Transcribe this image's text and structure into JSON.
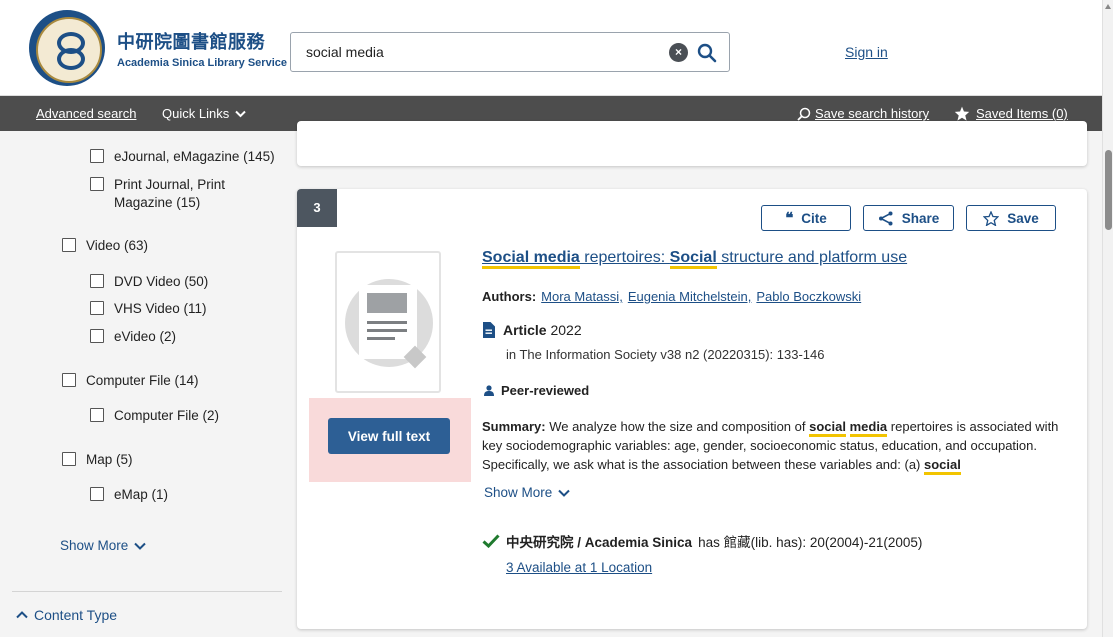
{
  "header": {
    "logo_zh": "中研院圖書館服務",
    "logo_en": "Academia Sinica Library Service",
    "search_value": "social media",
    "signin": "Sign in"
  },
  "nav": {
    "advanced_search": "Advanced search",
    "quick_links": "Quick Links",
    "save_history": "Save search history",
    "saved_items": "Saved Items (0)"
  },
  "sidebar": {
    "facets": [
      {
        "label": "eJournal, eMagazine (145)"
      },
      {
        "label": "Print Journal, Print Magazine (15)"
      },
      {
        "label": "Video (63)"
      },
      {
        "label": "DVD Video (50)"
      },
      {
        "label": "VHS Video (11)"
      },
      {
        "label": "eVideo (2)"
      },
      {
        "label": "Computer File (14)"
      },
      {
        "label": "Computer File (2)"
      },
      {
        "label": "Map (5)"
      },
      {
        "label": "eMap (1)"
      }
    ],
    "show_more": "Show More",
    "content_type": "Content Type"
  },
  "result": {
    "rank": "3",
    "cite": "Cite",
    "share": "Share",
    "save": "Save",
    "title_parts": [
      "Social media",
      " repertoires: ",
      "Social",
      " structure and platform use"
    ],
    "authors_label": "Authors:",
    "authors": [
      "Mora Matassi,",
      "Eugenia Mitchelstein,",
      "Pablo Boczkowski"
    ],
    "type_label": "Article",
    "year": "2022",
    "publication": "in The Information Society  v38 n2 (20220315): 133-146",
    "peer_reviewed": "Peer-reviewed",
    "summary_label": "Summary:",
    "summary_parts": [
      " We analyze how the size and composition of ",
      "social",
      " ",
      "media",
      " repertoires is associated with key sociodemographic variables: age, gender, socioeconomic status, education, and occupation. Specifically, we ask what is the association between these variables and: (a) ",
      "social"
    ],
    "view_full_text": "View full text",
    "show_more": "Show More",
    "holding_library": "中央研究院 / Academia Sinica",
    "holding_text": "has 館藏(lib. has): 20(2004)-21(2005)",
    "availability": "3 Available at 1 Location"
  }
}
